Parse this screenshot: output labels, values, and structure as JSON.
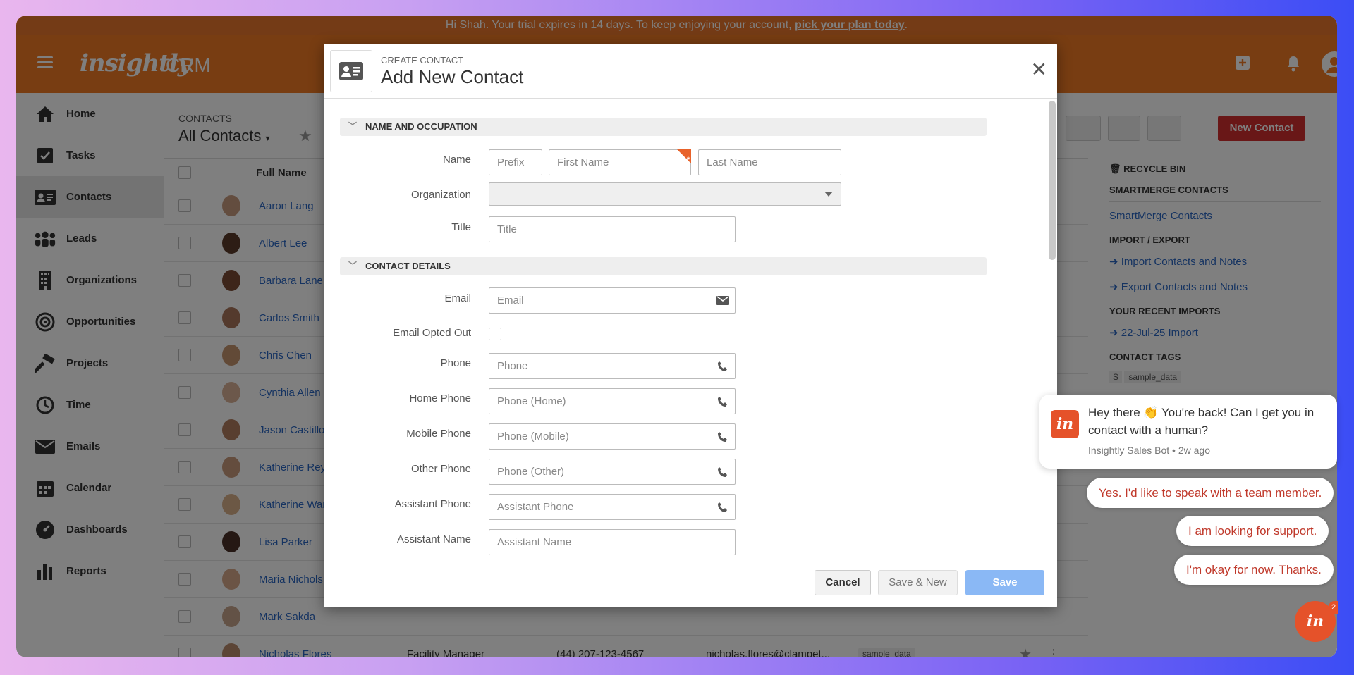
{
  "banner": {
    "text": "Hi Shah. Your trial expires in 14 days. To keep enjoying your account,",
    "link": "pick your plan today",
    "end": "."
  },
  "topbar": {
    "logo": "insightly",
    "product": "CRM",
    "icons": [
      "plus-square-icon",
      "bell-icon",
      "user-avatar-icon"
    ]
  },
  "sidebar": {
    "items": [
      {
        "label": "Home",
        "icon": "home-icon"
      },
      {
        "label": "Tasks",
        "icon": "checkbox-icon"
      },
      {
        "label": "Contacts",
        "icon": "contact-card-icon",
        "active": true
      },
      {
        "label": "Leads",
        "icon": "people-icon"
      },
      {
        "label": "Organizations",
        "icon": "building-icon"
      },
      {
        "label": "Opportunities",
        "icon": "target-icon"
      },
      {
        "label": "Projects",
        "icon": "hammer-icon"
      },
      {
        "label": "Time",
        "icon": "clock-icon"
      },
      {
        "label": "Emails",
        "icon": "envelope-icon"
      },
      {
        "label": "Calendar",
        "icon": "calendar-icon"
      },
      {
        "label": "Dashboards",
        "icon": "gauge-icon"
      },
      {
        "label": "Reports",
        "icon": "bar-chart-icon"
      }
    ]
  },
  "list": {
    "breadcrumb": "CONTACTS",
    "view_title": "All Contacts",
    "columns": {
      "full_name": "Full Name"
    },
    "rows": [
      {
        "name": "Aaron Lang"
      },
      {
        "name": "Albert Lee"
      },
      {
        "name": "Barbara Lane"
      },
      {
        "name": "Carlos Smith"
      },
      {
        "name": "Chris Chen"
      },
      {
        "name": "Cynthia Allen"
      },
      {
        "name": "Jason Castillo"
      },
      {
        "name": "Katherine Rey"
      },
      {
        "name": "Katherine War"
      },
      {
        "name": "Lisa Parker"
      },
      {
        "name": "Maria Nichols"
      },
      {
        "name": "Mark Sakda"
      },
      {
        "name": "Nicholas Flores",
        "role": "Facility Manager",
        "phone": "(44) 207-123-4567",
        "email": "nicholas.flores@clampet...",
        "tag": "sample_data"
      }
    ],
    "new_contact": "New Contact"
  },
  "right_panel": {
    "recycle_bin": "RECYCLE BIN",
    "smartmerge_header": "SMARTMERGE CONTACTS",
    "smartmerge_link": "SmartMerge Contacts",
    "import_header": "IMPORT / EXPORT",
    "import_link": "Import Contacts and Notes",
    "export_link": "Export Contacts and Notes",
    "recent_header": "YOUR RECENT IMPORTS",
    "recent_link": "22-Jul-25 Import",
    "tags_header": "CONTACT TAGS",
    "tag": "sample_data",
    "tag_letter": "S"
  },
  "modal": {
    "subtitle": "CREATE CONTACT",
    "title": "Add New Contact",
    "sections": {
      "name_occ": "NAME AND OCCUPATION",
      "contact_details": "CONTACT DETAILS"
    },
    "labels": {
      "name": "Name",
      "organization": "Organization",
      "title": "Title",
      "email": "Email",
      "email_opted_out": "Email Opted Out",
      "phone": "Phone",
      "home_phone": "Home Phone",
      "mobile_phone": "Mobile Phone",
      "other_phone": "Other Phone",
      "assistant_phone": "Assistant Phone",
      "assistant_name": "Assistant Name"
    },
    "placeholders": {
      "prefix": "Prefix",
      "first_name": "First Name",
      "last_name": "Last Name",
      "title": "Title",
      "email": "Email",
      "phone": "Phone",
      "home_phone": "Phone (Home)",
      "mobile_phone": "Phone (Mobile)",
      "other_phone": "Phone (Other)",
      "assistant_phone": "Assistant Phone",
      "assistant_name": "Assistant Name"
    },
    "buttons": {
      "cancel": "Cancel",
      "save_new": "Save & New",
      "save": "Save"
    }
  },
  "chat": {
    "message": "Hey there 👏 You're back! Can I get you in contact with a human?",
    "meta": "Insightly Sales Bot • 2w ago",
    "badge": "in",
    "replies": [
      "Yes. I'd like to speak with a team member.",
      "I am looking for support.",
      "I'm okay for now. Thanks."
    ],
    "unread": "2"
  },
  "colors": {
    "brand_orange": "#f07a25",
    "link_blue": "#2a66c2",
    "new_contact_red": "#d32f2f",
    "save_blue": "#8ab8f5"
  }
}
